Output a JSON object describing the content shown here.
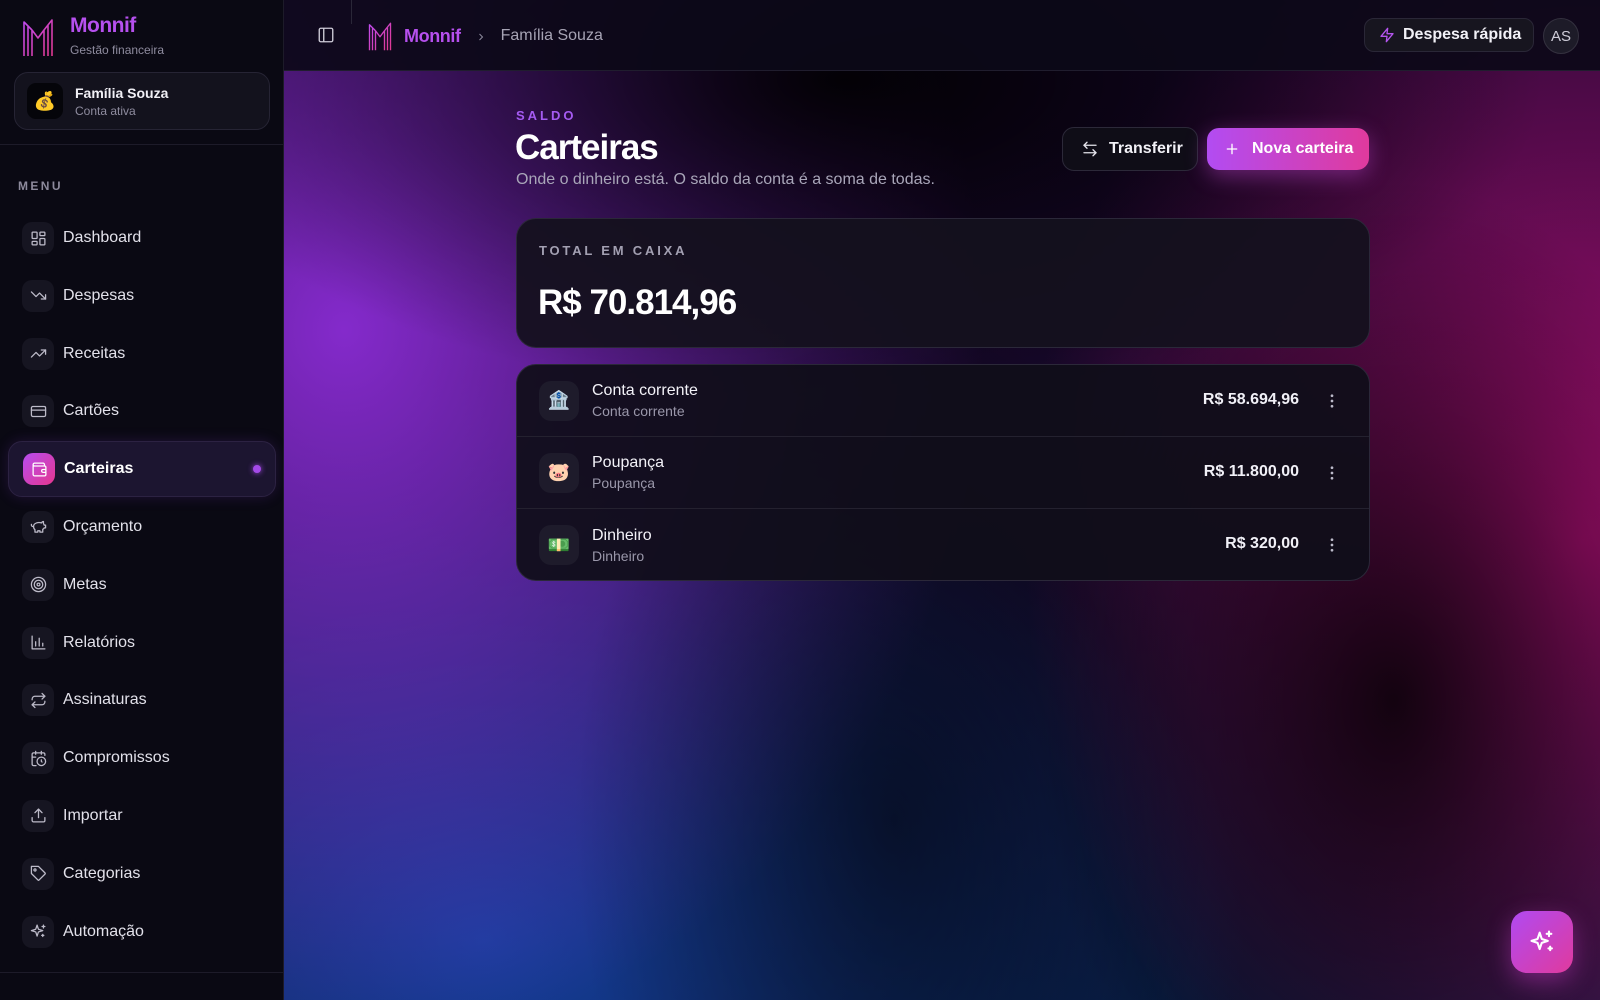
{
  "brand": {
    "name": "Monnif",
    "subtitle": "Gestão financeira",
    "color": "#b650ee"
  },
  "account": {
    "name": "Família Souza",
    "status": "Conta ativa",
    "icon": "money-bag-icon"
  },
  "sidebar": {
    "menu_label": "MENU",
    "items": [
      {
        "label": "Dashboard",
        "icon": "dashboard-icon",
        "active": false
      },
      {
        "label": "Despesas",
        "icon": "trending-down-icon",
        "active": false
      },
      {
        "label": "Receitas",
        "icon": "trending-up-icon",
        "active": false
      },
      {
        "label": "Cartões",
        "icon": "credit-card-icon",
        "active": false
      },
      {
        "label": "Carteiras",
        "icon": "wallet-icon",
        "active": true
      },
      {
        "label": "Orçamento",
        "icon": "piggy-bank-icon",
        "active": false
      },
      {
        "label": "Metas",
        "icon": "target-icon",
        "active": false
      },
      {
        "label": "Relatórios",
        "icon": "bar-chart-icon",
        "active": false
      },
      {
        "label": "Assinaturas",
        "icon": "repeat-icon",
        "active": false
      },
      {
        "label": "Compromissos",
        "icon": "calendar-clock-icon",
        "active": false
      },
      {
        "label": "Importar",
        "icon": "upload-icon",
        "active": false
      },
      {
        "label": "Categorias",
        "icon": "tag-icon",
        "active": false
      },
      {
        "label": "Automação",
        "icon": "sparkles-icon",
        "active": false
      }
    ]
  },
  "topbar": {
    "breadcrumb_home": "Monnif",
    "breadcrumb_current": "Família Souza",
    "quick_expense_label": "Despesa rápida",
    "user_initials": "AS"
  },
  "page": {
    "eyebrow": "SALDO",
    "title": "Carteiras",
    "subtitle": "Onde o dinheiro está. O saldo da conta é a soma de todas.",
    "transfer_label": "Transferir",
    "new_wallet_label": "Nova carteira"
  },
  "total": {
    "label": "TOTAL EM CAIXA",
    "value": "R$ 70.814,96"
  },
  "wallets": [
    {
      "name": "Conta corrente",
      "type": "Conta corrente",
      "amount": "R$ 58.694,96",
      "icon": "bank-icon",
      "glyph": "🏦"
    },
    {
      "name": "Poupança",
      "type": "Poupança",
      "amount": "R$ 11.800,00",
      "icon": "pig-icon",
      "glyph": "🐷"
    },
    {
      "name": "Dinheiro",
      "type": "Dinheiro",
      "amount": "R$ 320,00",
      "icon": "cash-icon",
      "glyph": "💵"
    }
  ],
  "colors": {
    "accent_purple": "#b24cf2",
    "accent_pink": "#e03a9d",
    "background": "#06050c"
  }
}
